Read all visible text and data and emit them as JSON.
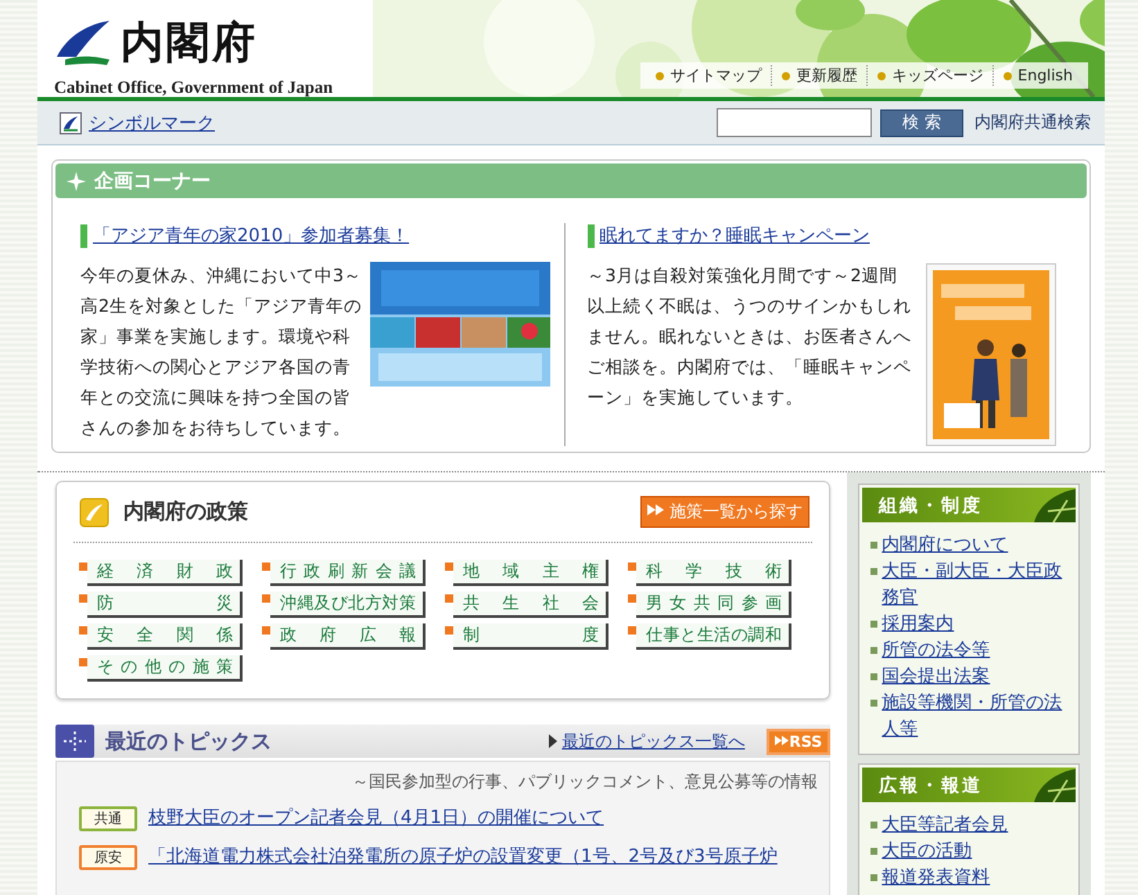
{
  "header": {
    "logo_title": "内閣府",
    "logo_subtitle": "Cabinet Office, Government of Japan",
    "links": [
      "サイトマップ",
      "更新履歴",
      "キッズページ",
      "English"
    ]
  },
  "toolbar": {
    "symbol_link": "シンボルマーク",
    "search_button": "検 索",
    "search_label": "内閣府共通検索"
  },
  "feature": {
    "title": "企画コーナー",
    "items": [
      {
        "heading": "「アジア青年の家2010」参加者募集！",
        "body": "今年の夏休み、沖縄において中3～高2生を対象とした「アジア青年の家」事業を実施します。環境や科学技術への関心とアジア各国の青年との交流に興味を持つ全国の皆さんの参加をお待ちしています。"
      },
      {
        "heading": "眠れてますか？睡眠キャンペーン",
        "body": "～3月は自殺対策強化月間です～2週間以上続く不眠は、うつのサインかもしれません。眠れないときは、お医者さんへご相談を。内閣府では、「睡眠キャンペーン」を実施しています。"
      }
    ]
  },
  "policy": {
    "title": "内閣府の政策",
    "button": "施策一覧から探す",
    "items": [
      "経済財政",
      "行政刷新会議",
      "地域主権",
      "科学技術",
      "防災",
      "沖縄及び北方対策",
      "共生社会",
      "男女共同参画",
      "安全関係",
      "政府広報",
      "制度",
      "仕事と生活の調和",
      "その他の施策"
    ]
  },
  "topics": {
    "title": "最近のトピックス",
    "list_link": "最近のトピックス一覧へ",
    "rss": "RSS",
    "note": "～国民参加型の行事、パブリックコメント、意見公募等の情報",
    "items": [
      {
        "tag": "共通",
        "color": "#8cb43c",
        "text": "枝野大臣のオープン記者会見（4月1日）の開催について"
      },
      {
        "tag": "原安",
        "color": "#f08030",
        "text": "「北海道電力株式会社泊発電所の原子炉の設置変更（1号、2号及び3号原子炉"
      }
    ]
  },
  "sidebar": [
    {
      "title": "組織・制度",
      "items": [
        "内閣府について",
        "大臣・副大臣・大臣政務官",
        "採用案内",
        "所管の法令等",
        "国会提出法案",
        "施設等機関・所管の法人等"
      ]
    },
    {
      "title": "広報・報道",
      "items": [
        "大臣等記者会見",
        "大臣の活動",
        "報道発表資料"
      ]
    }
  ]
}
